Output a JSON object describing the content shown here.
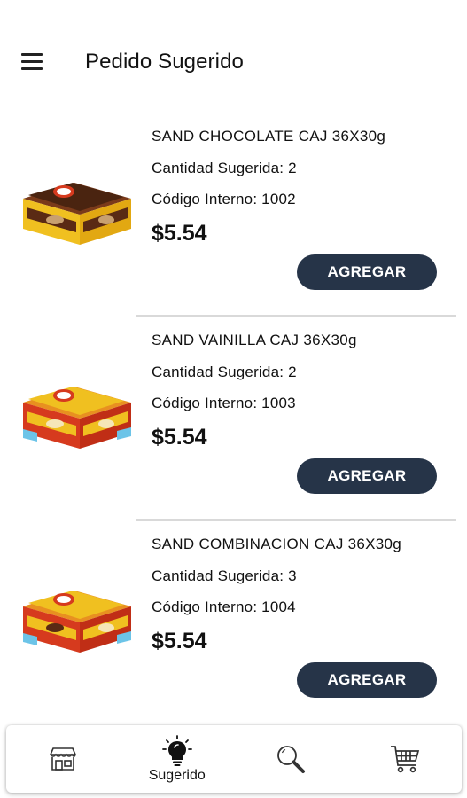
{
  "header": {
    "title": "Pedido Sugerido",
    "menu_icon": "hamburger-menu-icon"
  },
  "products": [
    {
      "name": "SAND CHOCOLATE CAJ 36X30g",
      "quantity": "Cantidad Sugerida: 2",
      "code": "Código Interno: 1002",
      "price": "$5.54",
      "button_label": "AGREGAR",
      "box_color": "#f0c020",
      "accent_color": "#5a2a14"
    },
    {
      "name": "SAND VAINILLA CAJ 36X30g",
      "quantity": "Cantidad Sugerida: 2",
      "code": "Código Interno: 1003",
      "price": "$5.54",
      "button_label": "AGREGAR",
      "box_color": "#f0c020",
      "accent_color": "#d63a1e"
    },
    {
      "name": "SAND COMBINACION CAJ 36X30g",
      "quantity": "Cantidad Sugerida: 3",
      "code": "Código Interno: 1004",
      "price": "$5.54",
      "button_label": "AGREGAR",
      "box_color": "#f0c020",
      "accent_color": "#d63a1e"
    }
  ],
  "bottom_nav": {
    "items": [
      {
        "icon": "store-icon",
        "label": ""
      },
      {
        "icon": "lightbulb-icon",
        "label": "Sugerido"
      },
      {
        "icon": "search-icon",
        "label": ""
      },
      {
        "icon": "cart-icon",
        "label": ""
      }
    ]
  },
  "colors": {
    "button_bg": "#263448",
    "button_text": "#ffffff",
    "divider": "#d9d9d9"
  }
}
